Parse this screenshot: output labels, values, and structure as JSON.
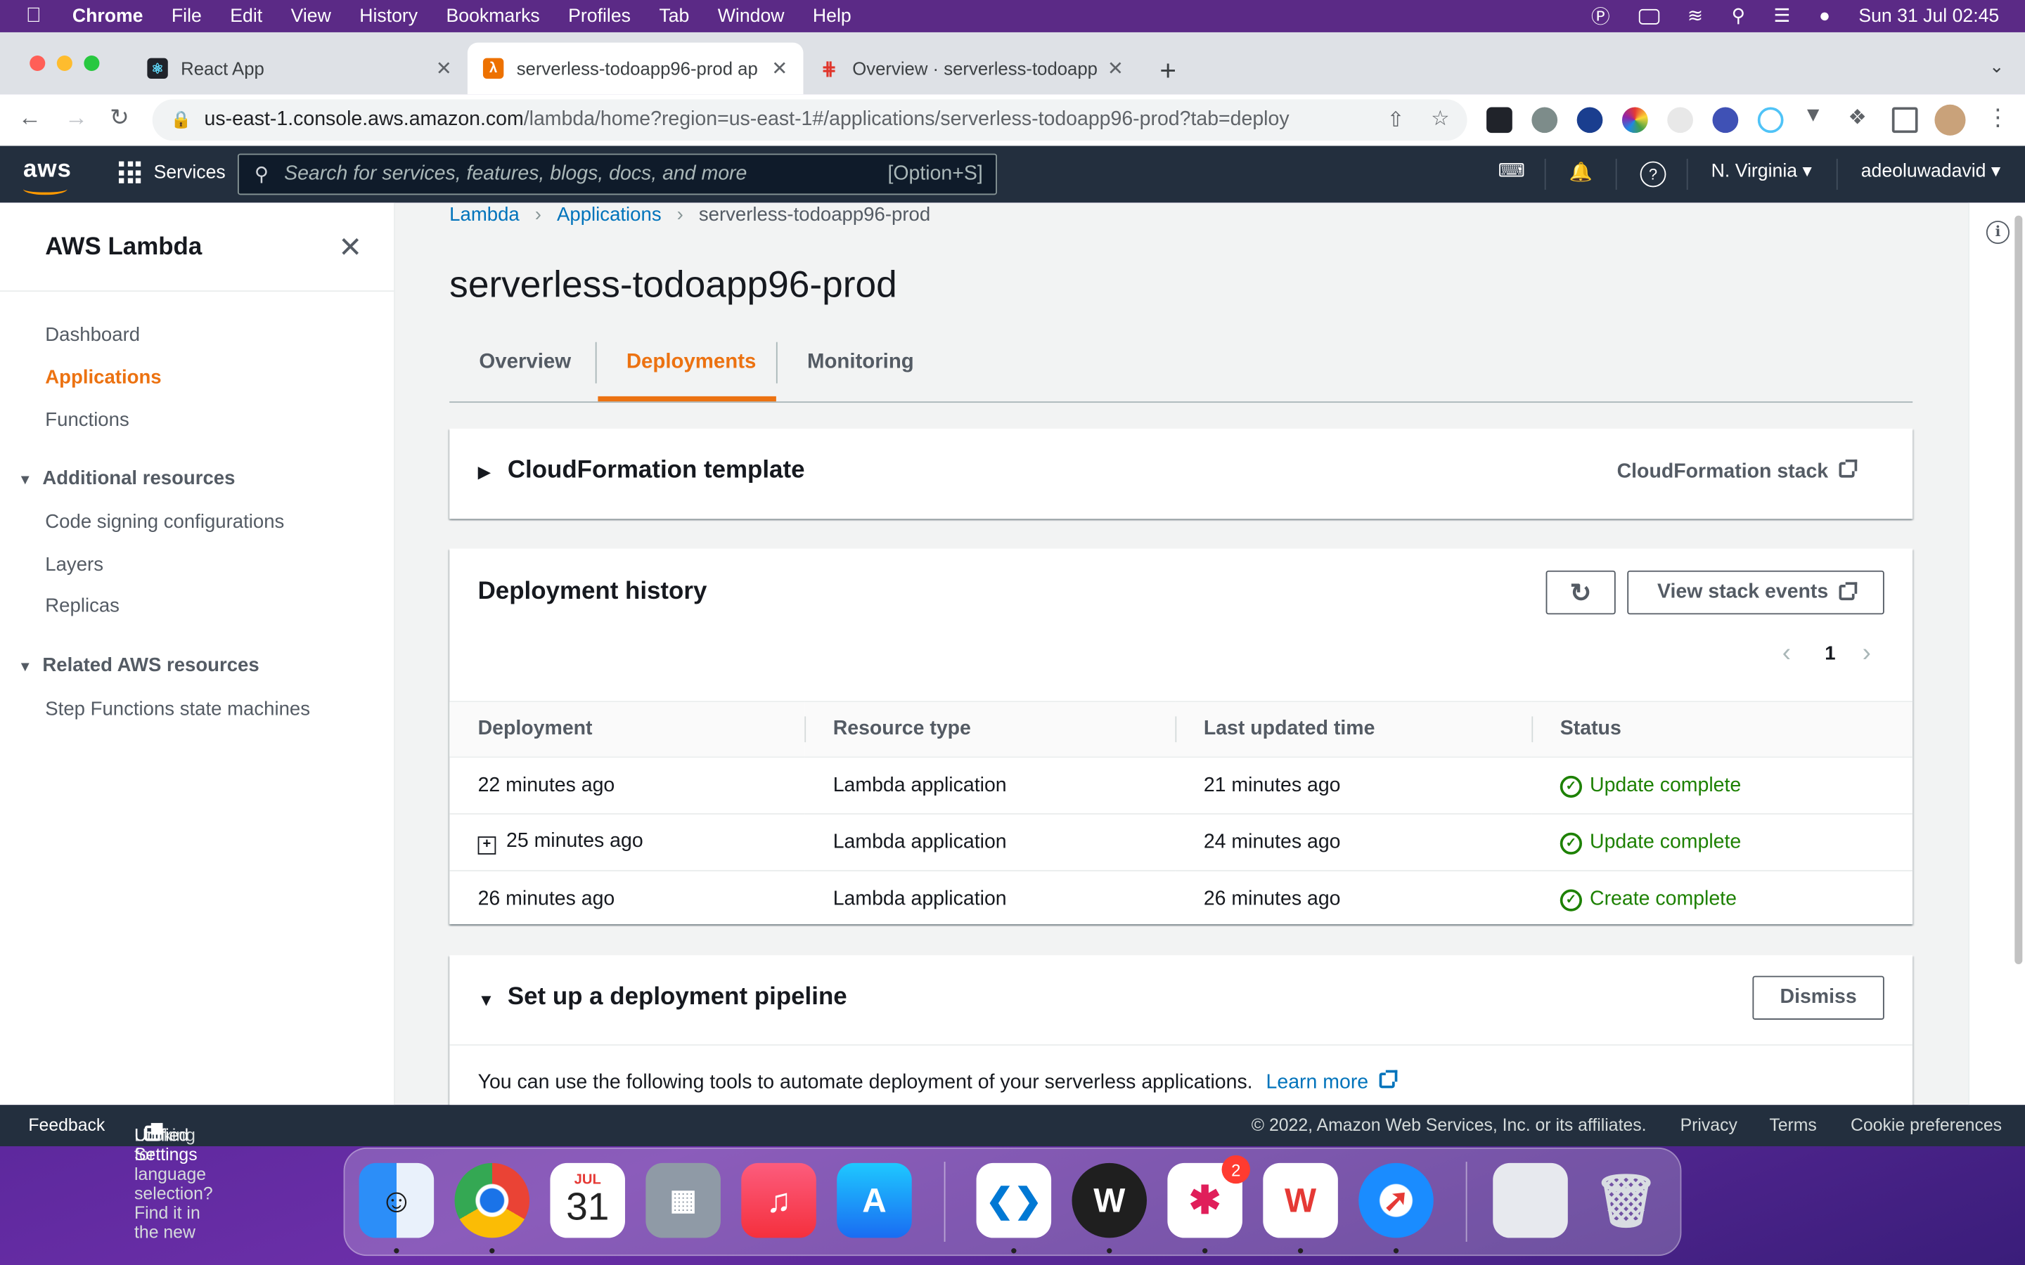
{
  "menubar": {
    "app": "Chrome",
    "items": [
      "File",
      "Edit",
      "View",
      "History",
      "Bookmarks",
      "Profiles",
      "Tab",
      "Window",
      "Help"
    ],
    "datetime": "Sun 31 Jul  02:45"
  },
  "browser": {
    "tabs": [
      {
        "title": "React App"
      },
      {
        "title": "serverless-todoapp96-prod ap"
      },
      {
        "title": "Overview · serverless-todoapp"
      }
    ],
    "url_host": "us-east-1.console.aws.amazon.com",
    "url_path": "/lambda/home?region=us-east-1#/applications/serverless-todoapp96-prod?tab=deploy"
  },
  "awsnav": {
    "logo": "aws",
    "services": "Services",
    "search_placeholder": "Search for services, features, blogs, docs, and more",
    "search_shortcut": "[Option+S]",
    "region": "N. Virginia ▾",
    "user": "adeoluwadavid ▾"
  },
  "sidenav": {
    "title": "AWS Lambda",
    "items": [
      "Dashboard",
      "Applications",
      "Functions"
    ],
    "section1": {
      "label": "Additional resources",
      "items": [
        "Code signing configurations",
        "Layers",
        "Replicas"
      ]
    },
    "section2": {
      "label": "Related AWS resources",
      "items": [
        "Step Functions state machines"
      ]
    }
  },
  "breadcrumb": [
    "Lambda",
    "Applications",
    "serverless-todoapp96-prod"
  ],
  "page_title": "serverless-todoapp96-prod",
  "tabs": [
    "Overview",
    "Deployments",
    "Monitoring"
  ],
  "cfn": {
    "title": "CloudFormation template",
    "stack_link": "CloudFormation stack"
  },
  "history": {
    "title": "Deployment history",
    "view_events": "View stack events",
    "page": "1",
    "columns": [
      "Deployment",
      "Resource type",
      "Last updated time",
      "Status"
    ],
    "rows": [
      {
        "deployment": "22 minutes ago",
        "resource": "Lambda application",
        "updated": "21 minutes ago",
        "status": "Update complete"
      },
      {
        "deployment": "25 minutes ago",
        "resource": "Lambda application",
        "updated": "24 minutes ago",
        "status": "Update complete"
      },
      {
        "deployment": "26 minutes ago",
        "resource": "Lambda application",
        "updated": "26 minutes ago",
        "status": "Create complete"
      }
    ]
  },
  "pipeline": {
    "title": "Set up a deployment pipeline",
    "dismiss": "Dismiss",
    "text": "You can use the following tools to automate deployment of your serverless applications.",
    "learn_more": "Learn more"
  },
  "footer": {
    "feedback": "Feedback",
    "lang_text": "Looking for language selection? Find it in the new",
    "unified": "Unified Settings",
    "copyright": "© 2022, Amazon Web Services, Inc. or its affiliates.",
    "privacy": "Privacy",
    "terms": "Terms",
    "cookies": "Cookie preferences"
  },
  "dock": {
    "calendar_month": "JUL",
    "calendar_day": "31",
    "slack_badge": "2"
  },
  "colors": {
    "aws_orange": "#ec7211",
    "link_blue": "#0073bb",
    "success_green": "#1d8102",
    "aws_nav": "#232f3e"
  }
}
